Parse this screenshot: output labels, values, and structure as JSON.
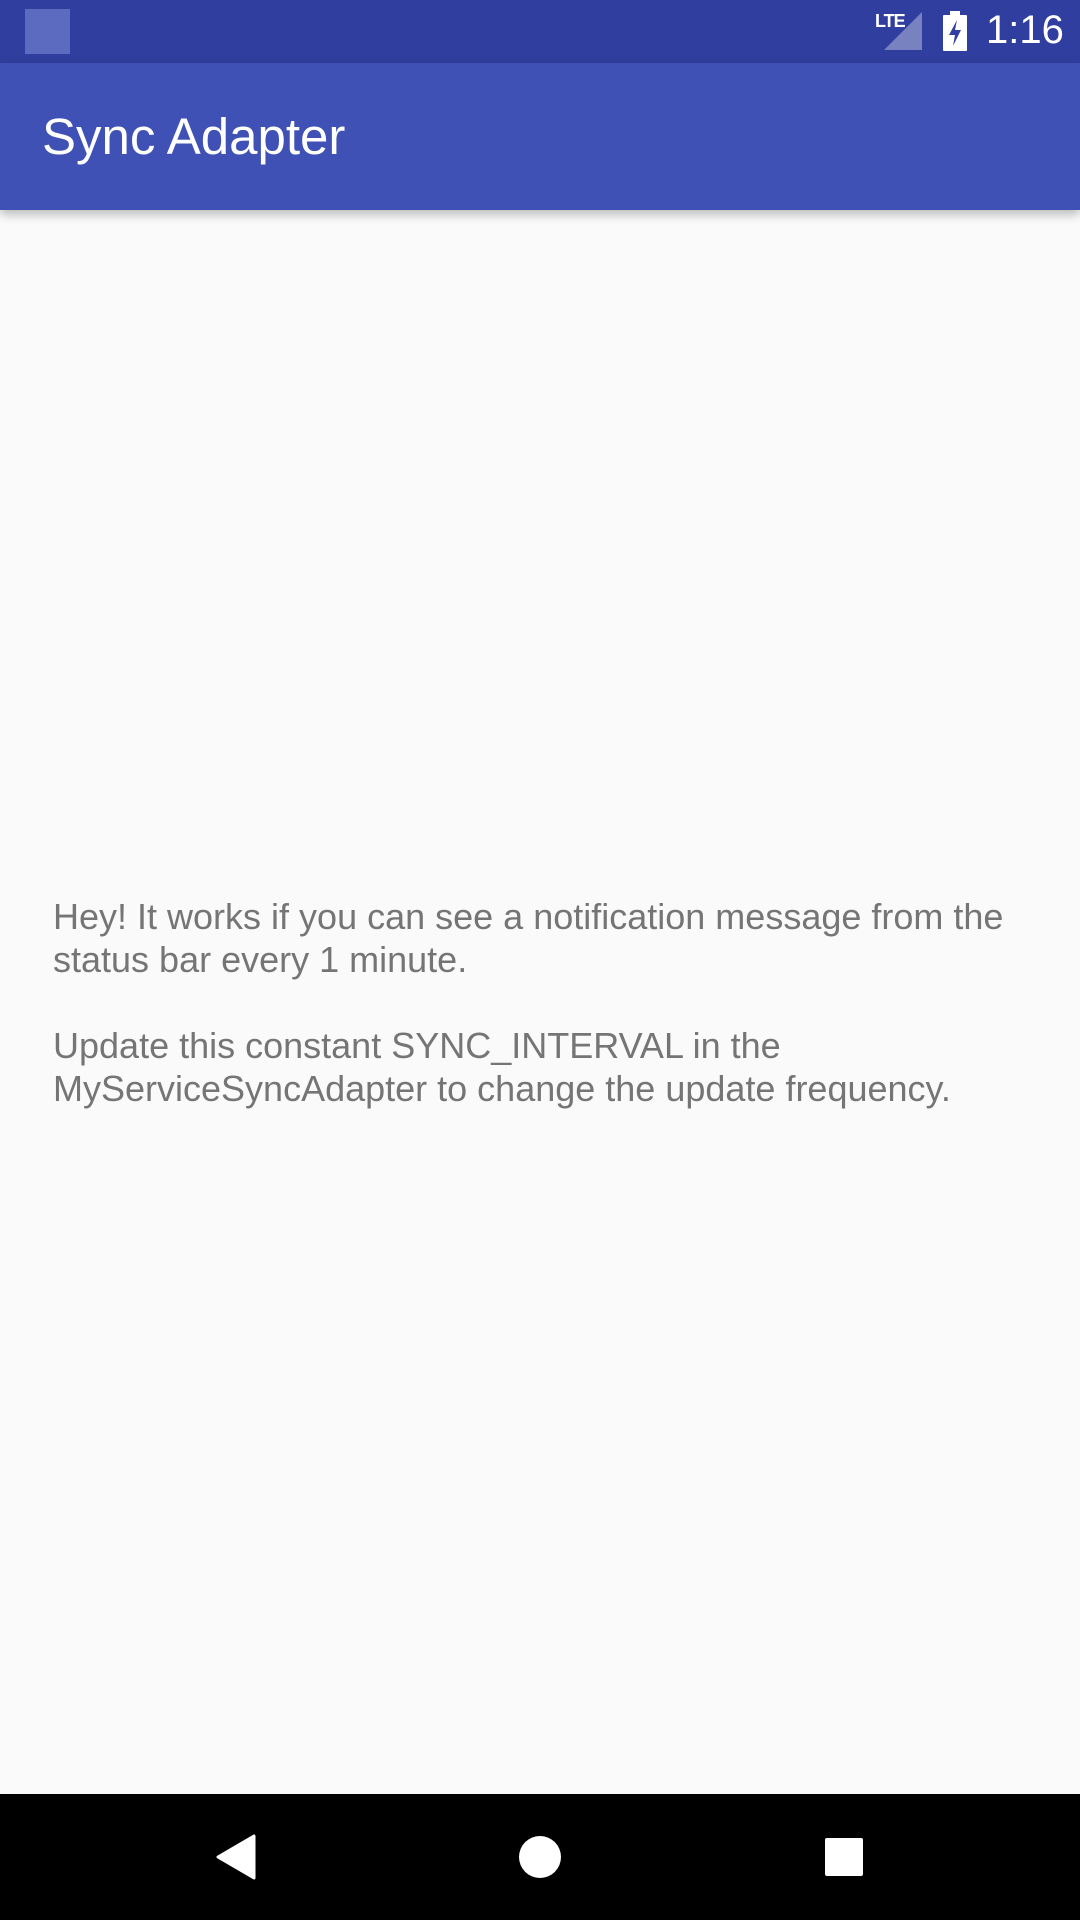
{
  "status_bar": {
    "network": "LTE",
    "time": "1:16",
    "icons": [
      "notification-icon",
      "signal-icon",
      "battery-charging-icon"
    ]
  },
  "app_bar": {
    "title": "Sync Adapter"
  },
  "content": {
    "paragraph_1": "Hey! It works if you can see a notification message from the status bar every 1 minute.",
    "paragraph_2": "Update this constant SYNC_INTERVAL in the MyServiceSyncAdapter to change the update frequency."
  },
  "nav_bar": {
    "icons": [
      "back-icon",
      "home-icon",
      "recents-icon"
    ]
  },
  "colors": {
    "status_bar": "#303f9f",
    "app_bar": "#3f51b5",
    "background": "#fafafa",
    "body_text": "#757575",
    "nav_bar": "#000000"
  }
}
